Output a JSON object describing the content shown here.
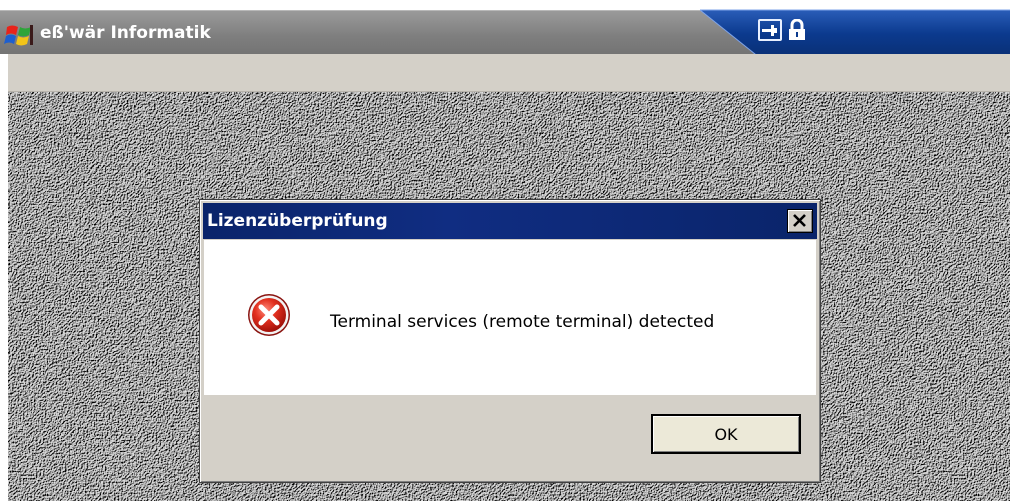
{
  "app": {
    "title": "eß'wär Informatik",
    "logo_icon": "windows-flag-icon"
  },
  "connection_bar": {
    "pin_icon": "pin-icon",
    "lock_icon": "lock-icon",
    "color": "#0b3a8e"
  },
  "dialog": {
    "title": "Lizenzüberprüfung",
    "close_icon": "close-icon",
    "message_icon": "error-icon",
    "message": "Terminal services (remote terminal) detected",
    "ok_label": "OK"
  },
  "colors": {
    "dialog_titlebar": "#0a246a",
    "dialog_face": "#d4d0c8",
    "app_titlebar": "#858585",
    "error_red": "#d8261c"
  }
}
